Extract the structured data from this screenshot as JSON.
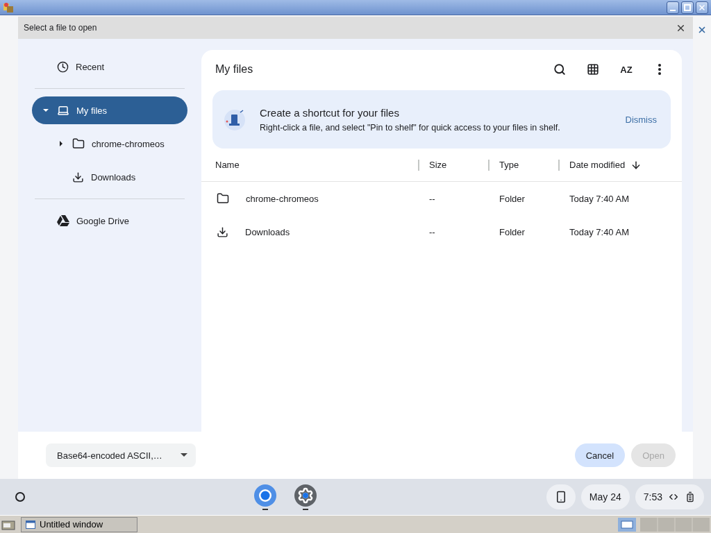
{
  "dialog": {
    "title": "Select a file to open"
  },
  "sidebar": {
    "groups": [
      {
        "items": [
          {
            "kind": "recent",
            "label": "Recent",
            "selected": false
          }
        ]
      },
      {
        "items": [
          {
            "kind": "computer",
            "label": "My files",
            "selected": true,
            "expanded": true,
            "children": [
              {
                "kind": "folder",
                "label": "chrome-chromeos",
                "selected": false,
                "expanded": false,
                "has_children": true
              },
              {
                "kind": "download",
                "label": "Downloads",
                "selected": false
              }
            ]
          }
        ]
      },
      {
        "items": [
          {
            "kind": "drive",
            "label": "Google Drive",
            "selected": false
          }
        ]
      }
    ]
  },
  "main": {
    "title": "My files",
    "sort_button": "AZ",
    "banner": {
      "title": "Create a shortcut for your files",
      "text": "Right-click a file, and select \"Pin to shelf\" for quick access to your files in shelf.",
      "action": "Dismiss"
    },
    "table": {
      "columns": [
        {
          "label": "Name",
          "sorted": false
        },
        {
          "label": "Size",
          "sorted": false
        },
        {
          "label": "Type",
          "sorted": false
        },
        {
          "label": "Date modified",
          "sorted": true
        }
      ],
      "rows": [
        {
          "kind": "folder",
          "name": "chrome-chromeos",
          "size": "--",
          "type": "Folder",
          "date": "Today 7:40 AM"
        },
        {
          "kind": "download",
          "name": "Downloads",
          "size": "--",
          "type": "Folder",
          "date": "Today 7:40 AM"
        }
      ]
    }
  },
  "footer": {
    "file_type": "Base64-encoded ASCII,…",
    "buttons": [
      {
        "label": "Cancel",
        "disabled": false
      },
      {
        "label": "Open",
        "disabled": true
      }
    ]
  },
  "shelf": {
    "date": "May 24",
    "time": "7:53"
  },
  "taskbar": {
    "tasks": [
      {
        "label": "Untitled window"
      }
    ]
  }
}
